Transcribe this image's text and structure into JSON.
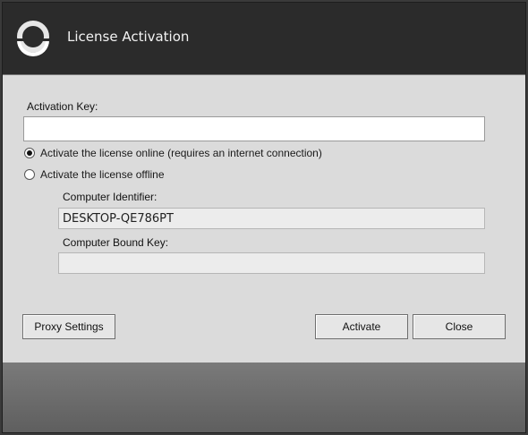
{
  "window": {
    "title": "License Activation",
    "logo_icon": "circle-logo-icon"
  },
  "form": {
    "activation_key_label": "Activation Key:",
    "activation_key_value": "",
    "online_option_label": "Activate the license online (requires an internet connection)",
    "offline_option_label": "Activate the license offline",
    "selected_option": "online",
    "computer_identifier_label": "Computer Identifier:",
    "computer_identifier_value": "DESKTOP-QE786PT",
    "computer_bound_key_label": "Computer Bound Key:",
    "computer_bound_key_value": ""
  },
  "buttons": {
    "proxy_settings": "Proxy Settings",
    "activate": "Activate",
    "close": "Close"
  },
  "colors": {
    "titlebar": "#2b2b2b",
    "body": "#dbdbdb",
    "footer": "#6a6a6a"
  }
}
